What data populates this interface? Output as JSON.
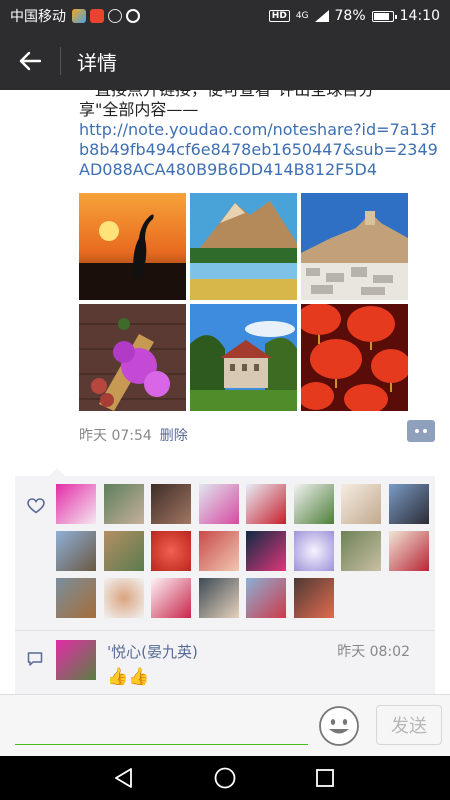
{
  "status_bar": {
    "carrier": "中国移动",
    "hd_badge": "HD",
    "network": "4G",
    "battery_percent": "78%",
    "battery_level": 0.78,
    "time": "14:10"
  },
  "nav": {
    "back_icon": "back-arrow-icon",
    "title": "详情"
  },
  "post": {
    "text_cut_top": "一直接点开链接，便可查看\"评出全球目分",
    "text_line2": "享\"全部内容——",
    "link": "http://note.youdao.com/noteshare?id=7a13fb8b49fb494cf6e8478eb1650447&sub=2349AD088ACA480B9B6DD414B812F5D4",
    "photos": [
      {
        "name": "photo-crane-sunset"
      },
      {
        "name": "photo-mountain-lake"
      },
      {
        "name": "photo-hilltop-village"
      },
      {
        "name": "photo-flowers-figs"
      },
      {
        "name": "photo-castle-mansion"
      },
      {
        "name": "photo-red-lanterns"
      }
    ],
    "time": "昨天 07:54",
    "delete_label": "删除"
  },
  "likes": {
    "icon": "heart-icon",
    "avatar_count": 22
  },
  "comments": [
    {
      "author": "'悦心(晏九英)",
      "time": "昨天 08:02",
      "body": "👍👍"
    }
  ],
  "input": {
    "placeholder": "",
    "emoji_icon": "emoji-icon",
    "send_label": "发送"
  },
  "system_nav": {
    "back": "triangle-back-icon",
    "home": "circle-home-icon",
    "recents": "square-recents-icon"
  },
  "colors": {
    "header_bg": "#2d2d2f",
    "link": "#3f6fb3",
    "name_blue": "#576b95",
    "accent_green": "#45c01a"
  }
}
